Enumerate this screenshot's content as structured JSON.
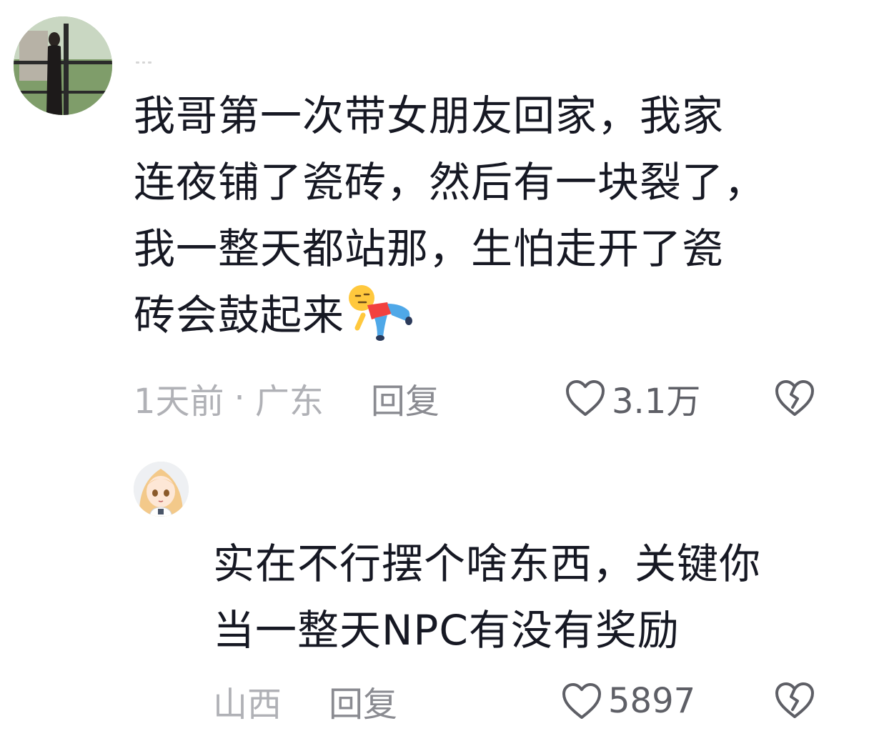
{
  "comments": [
    {
      "lines": [
        "我哥第一次带女朋友回家，我家",
        "连夜铺了瓷砖，然后有一块裂了，",
        "我一整天都站那，生怕走开了瓷",
        "砖会鼓起来"
      ],
      "emoji_icon": "lying-down-person-emoji",
      "time": "1天前",
      "separator": "·",
      "location": "广东",
      "reply_label": "回复",
      "like_count": "3.1万"
    },
    {
      "lines": [
        "实在不行摆个啥东西，关键你",
        "当一整天NPC有没有奖励"
      ],
      "location": "山西",
      "reply_label": "回复",
      "like_count": "5897"
    }
  ],
  "icons": {
    "like": "heart-outline-icon",
    "dislike": "broken-heart-icon"
  },
  "colors": {
    "text": "#161823",
    "meta": "#b0b1b6",
    "reply": "#8a8b91",
    "icon": "#5e5f66"
  }
}
